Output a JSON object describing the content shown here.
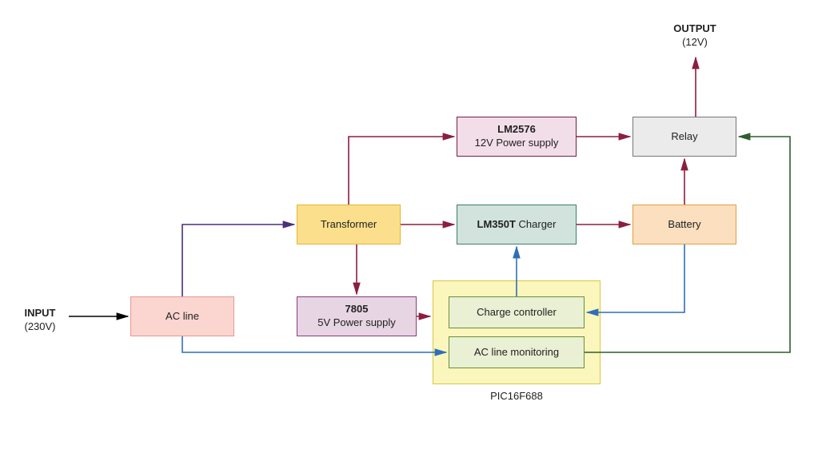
{
  "input": {
    "title": "INPUT",
    "sub": "(230V)"
  },
  "output": {
    "title": "OUTPUT",
    "sub": "(12V)"
  },
  "blocks": {
    "acline": {
      "label": "AC line"
    },
    "transformer": {
      "label": "Transformer"
    },
    "lm2576": {
      "bold": "LM2576",
      "sub": "12V Power supply"
    },
    "lm350t": {
      "bold": "LM350T",
      "rest": " Charger"
    },
    "reg7805": {
      "bold": "7805",
      "sub": "5V Power supply"
    },
    "battery": {
      "label": "Battery"
    },
    "relay": {
      "label": "Relay"
    },
    "chargectl": {
      "label": "Charge controller"
    },
    "aclinemon": {
      "label": "AC line monitoring"
    },
    "pic": {
      "label": "PIC16F688"
    }
  },
  "colors": {
    "acline_bg": "#fbd5cf",
    "acline_bd": "#e6998f",
    "transformer_bg": "#fbdf8c",
    "transformer_bd": "#e6b432",
    "lm2576_bg": "#f2dee9",
    "lm2576_bd": "#711f4d",
    "lm350t_bg": "#d1e3dc",
    "lm350t_bd": "#3b7d6a",
    "reg7805_bg": "#e7d5e3",
    "reg7805_bd": "#8a3b7c",
    "battery_bg": "#fbdfbf",
    "battery_bd": "#e69b3f",
    "relay_bg": "#ebebeb",
    "relay_bd": "#777777",
    "pic_bg": "#fbf6bc",
    "pic_bd": "#d6c845",
    "inner_bg": "#e9f0d3",
    "inner_bd": "#6b8f36",
    "arrow_black": "#000000",
    "arrow_purple": "#4a2f7b",
    "arrow_maroon": "#8b1e3f",
    "arrow_blue": "#2f6fb7",
    "arrow_green": "#2f5d2f"
  }
}
